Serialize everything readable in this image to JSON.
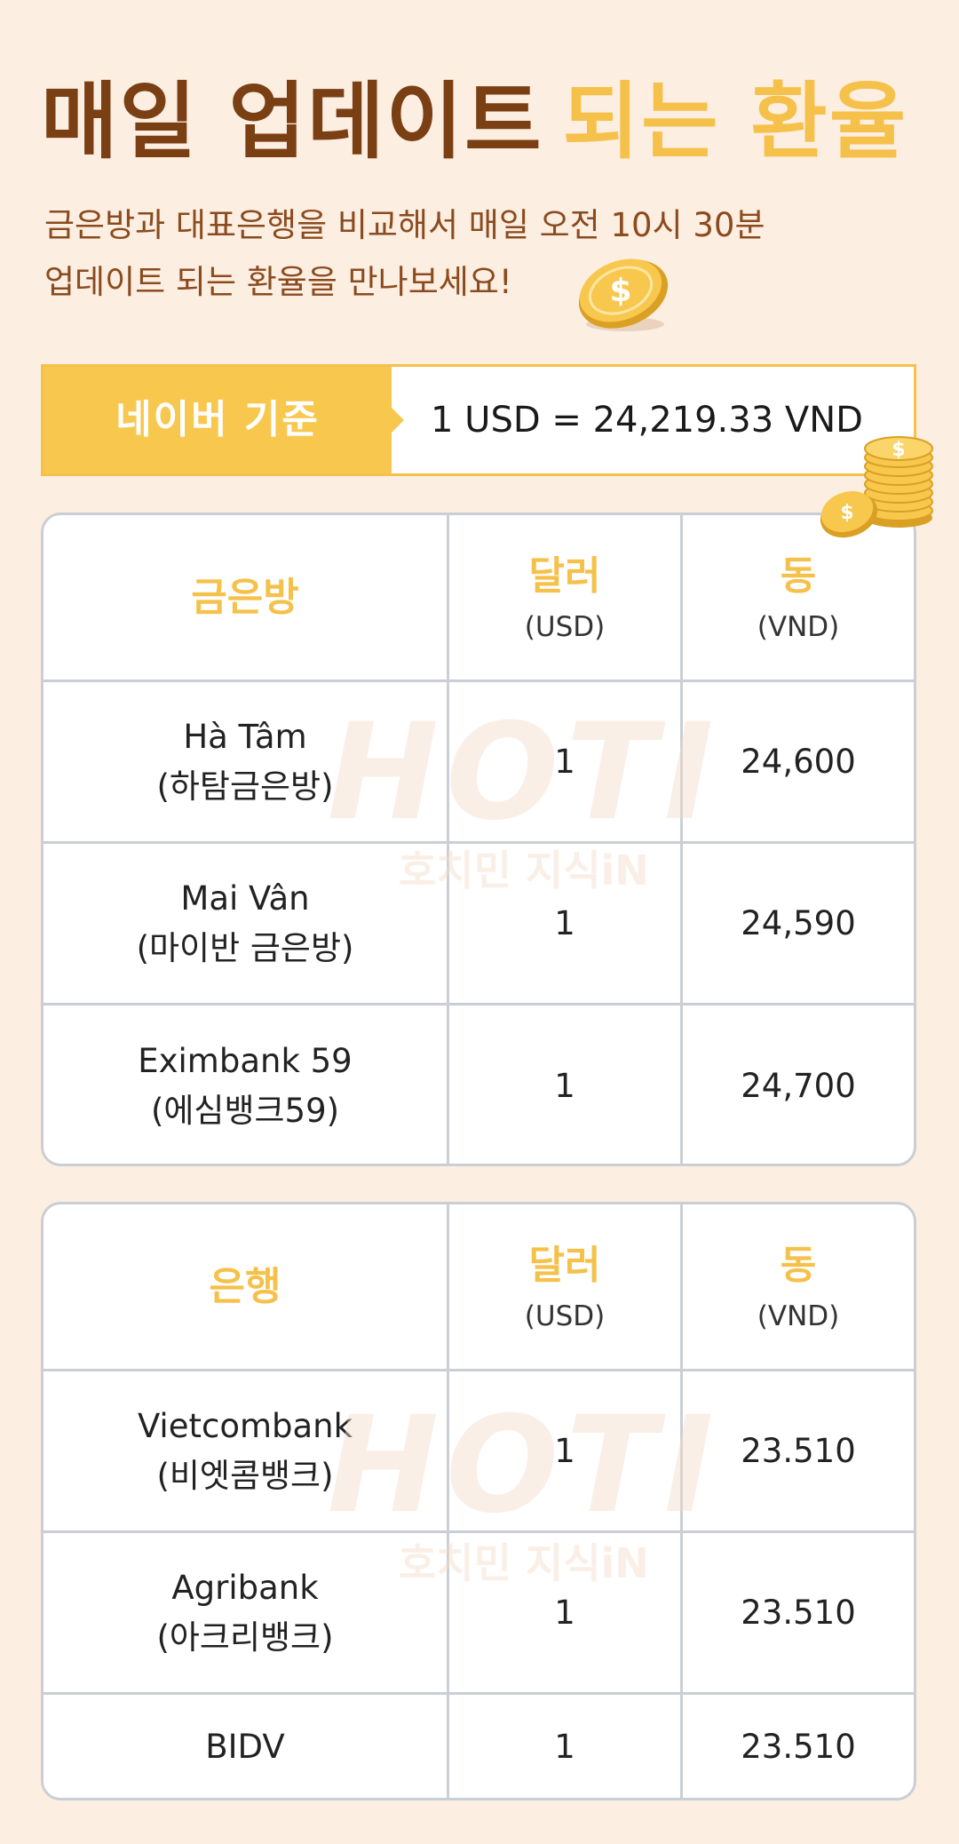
{
  "header": {
    "title_part1": "매일 업데이트",
    "title_part2": "되는 환율",
    "subtitle_line1": "금은방과 대표은행을 비교해서 매일 오전 10시 30분",
    "subtitle_line2": "업데이트 되는 환율을 만나보세요!"
  },
  "rate": {
    "label": "네이버 기준",
    "value": "1 USD = 24,219.33 VND"
  },
  "gold_table": {
    "header": {
      "col1": "금은방",
      "col2_main": "달러",
      "col2_sub": "(USD)",
      "col3_main": "동",
      "col3_sub": "(VND)"
    },
    "rows": [
      {
        "name": "Hà Tâm",
        "name_sub": "(하탐금은방)",
        "usd": "1",
        "vnd": "24,600"
      },
      {
        "name": "Mai Vân",
        "name_sub": "(마이반 금은방)",
        "usd": "1",
        "vnd": "24,590"
      },
      {
        "name": "Eximbank 59",
        "name_sub": "(에심뱅크59)",
        "usd": "1",
        "vnd": "24,700"
      }
    ]
  },
  "bank_table": {
    "header": {
      "col1": "은행",
      "col2_main": "달러",
      "col2_sub": "(USD)",
      "col3_main": "동",
      "col3_sub": "(VND)"
    },
    "rows": [
      {
        "name": "Vietcombank",
        "name_sub": "(비엣콤뱅크)",
        "usd": "1",
        "vnd": "23.510"
      },
      {
        "name": "Agribank",
        "name_sub": "(아크리뱅크)",
        "usd": "1",
        "vnd": "23.510"
      },
      {
        "name": "BIDV",
        "usd": "1",
        "vnd": "23.510"
      }
    ]
  },
  "watermark": {
    "logo": "HOTI",
    "text": "호치민 지식iN"
  },
  "colors": {
    "accent_yellow": "#f5c14b",
    "brown": "#7a3f12",
    "background": "#fdeee2",
    "border": "#c9cfd4"
  }
}
